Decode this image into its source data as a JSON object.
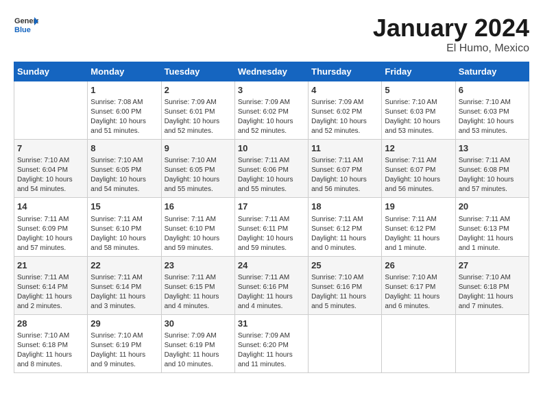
{
  "header": {
    "logo_general": "General",
    "logo_blue": "Blue",
    "month": "January 2024",
    "location": "El Humo, Mexico"
  },
  "days_of_week": [
    "Sunday",
    "Monday",
    "Tuesday",
    "Wednesday",
    "Thursday",
    "Friday",
    "Saturday"
  ],
  "weeks": [
    [
      {
        "day": "",
        "info": ""
      },
      {
        "day": "1",
        "info": "Sunrise: 7:08 AM\nSunset: 6:00 PM\nDaylight: 10 hours\nand 51 minutes."
      },
      {
        "day": "2",
        "info": "Sunrise: 7:09 AM\nSunset: 6:01 PM\nDaylight: 10 hours\nand 52 minutes."
      },
      {
        "day": "3",
        "info": "Sunrise: 7:09 AM\nSunset: 6:02 PM\nDaylight: 10 hours\nand 52 minutes."
      },
      {
        "day": "4",
        "info": "Sunrise: 7:09 AM\nSunset: 6:02 PM\nDaylight: 10 hours\nand 52 minutes."
      },
      {
        "day": "5",
        "info": "Sunrise: 7:10 AM\nSunset: 6:03 PM\nDaylight: 10 hours\nand 53 minutes."
      },
      {
        "day": "6",
        "info": "Sunrise: 7:10 AM\nSunset: 6:03 PM\nDaylight: 10 hours\nand 53 minutes."
      }
    ],
    [
      {
        "day": "7",
        "info": "Sunrise: 7:10 AM\nSunset: 6:04 PM\nDaylight: 10 hours\nand 54 minutes."
      },
      {
        "day": "8",
        "info": "Sunrise: 7:10 AM\nSunset: 6:05 PM\nDaylight: 10 hours\nand 54 minutes."
      },
      {
        "day": "9",
        "info": "Sunrise: 7:10 AM\nSunset: 6:05 PM\nDaylight: 10 hours\nand 55 minutes."
      },
      {
        "day": "10",
        "info": "Sunrise: 7:11 AM\nSunset: 6:06 PM\nDaylight: 10 hours\nand 55 minutes."
      },
      {
        "day": "11",
        "info": "Sunrise: 7:11 AM\nSunset: 6:07 PM\nDaylight: 10 hours\nand 56 minutes."
      },
      {
        "day": "12",
        "info": "Sunrise: 7:11 AM\nSunset: 6:07 PM\nDaylight: 10 hours\nand 56 minutes."
      },
      {
        "day": "13",
        "info": "Sunrise: 7:11 AM\nSunset: 6:08 PM\nDaylight: 10 hours\nand 57 minutes."
      }
    ],
    [
      {
        "day": "14",
        "info": "Sunrise: 7:11 AM\nSunset: 6:09 PM\nDaylight: 10 hours\nand 57 minutes."
      },
      {
        "day": "15",
        "info": "Sunrise: 7:11 AM\nSunset: 6:10 PM\nDaylight: 10 hours\nand 58 minutes."
      },
      {
        "day": "16",
        "info": "Sunrise: 7:11 AM\nSunset: 6:10 PM\nDaylight: 10 hours\nand 59 minutes."
      },
      {
        "day": "17",
        "info": "Sunrise: 7:11 AM\nSunset: 6:11 PM\nDaylight: 10 hours\nand 59 minutes."
      },
      {
        "day": "18",
        "info": "Sunrise: 7:11 AM\nSunset: 6:12 PM\nDaylight: 11 hours\nand 0 minutes."
      },
      {
        "day": "19",
        "info": "Sunrise: 7:11 AM\nSunset: 6:12 PM\nDaylight: 11 hours\nand 1 minute."
      },
      {
        "day": "20",
        "info": "Sunrise: 7:11 AM\nSunset: 6:13 PM\nDaylight: 11 hours\nand 1 minute."
      }
    ],
    [
      {
        "day": "21",
        "info": "Sunrise: 7:11 AM\nSunset: 6:14 PM\nDaylight: 11 hours\nand 2 minutes."
      },
      {
        "day": "22",
        "info": "Sunrise: 7:11 AM\nSunset: 6:14 PM\nDaylight: 11 hours\nand 3 minutes."
      },
      {
        "day": "23",
        "info": "Sunrise: 7:11 AM\nSunset: 6:15 PM\nDaylight: 11 hours\nand 4 minutes."
      },
      {
        "day": "24",
        "info": "Sunrise: 7:11 AM\nSunset: 6:16 PM\nDaylight: 11 hours\nand 4 minutes."
      },
      {
        "day": "25",
        "info": "Sunrise: 7:10 AM\nSunset: 6:16 PM\nDaylight: 11 hours\nand 5 minutes."
      },
      {
        "day": "26",
        "info": "Sunrise: 7:10 AM\nSunset: 6:17 PM\nDaylight: 11 hours\nand 6 minutes."
      },
      {
        "day": "27",
        "info": "Sunrise: 7:10 AM\nSunset: 6:18 PM\nDaylight: 11 hours\nand 7 minutes."
      }
    ],
    [
      {
        "day": "28",
        "info": "Sunrise: 7:10 AM\nSunset: 6:18 PM\nDaylight: 11 hours\nand 8 minutes."
      },
      {
        "day": "29",
        "info": "Sunrise: 7:10 AM\nSunset: 6:19 PM\nDaylight: 11 hours\nand 9 minutes."
      },
      {
        "day": "30",
        "info": "Sunrise: 7:09 AM\nSunset: 6:19 PM\nDaylight: 11 hours\nand 10 minutes."
      },
      {
        "day": "31",
        "info": "Sunrise: 7:09 AM\nSunset: 6:20 PM\nDaylight: 11 hours\nand 11 minutes."
      },
      {
        "day": "",
        "info": ""
      },
      {
        "day": "",
        "info": ""
      },
      {
        "day": "",
        "info": ""
      }
    ]
  ]
}
